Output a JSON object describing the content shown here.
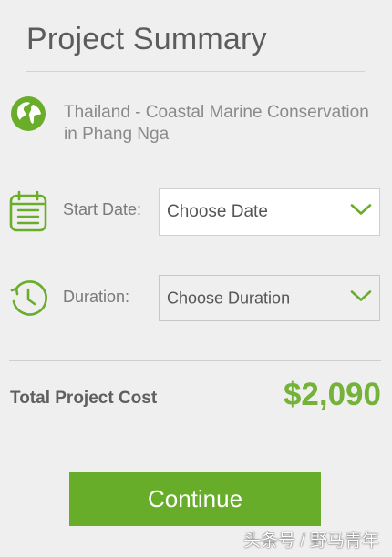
{
  "summary": {
    "title": "Project Summary",
    "project_name": "Thailand - Coastal Marine Conservation in Phang Nga"
  },
  "start_date": {
    "label": "Start Date:",
    "value": "Choose Date"
  },
  "duration": {
    "label": "Duration:",
    "value": "Choose Duration"
  },
  "total": {
    "label": "Total Project Cost",
    "value": "$2,090"
  },
  "actions": {
    "continue_label": "Continue"
  },
  "watermark": {
    "text": "头条号 / 野马青年"
  },
  "icons": {
    "project": "globe-icon",
    "start_date": "calendar-icon",
    "duration": "clock-icon",
    "select_arrow": "chevron-down-icon"
  },
  "colors": {
    "accent": "#6aad2b",
    "price": "#74b23a",
    "background": "#f0efef"
  }
}
